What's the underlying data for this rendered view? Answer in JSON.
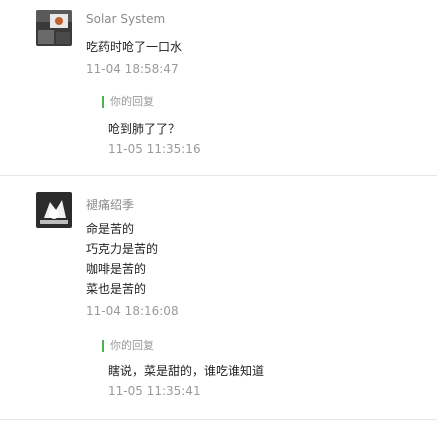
{
  "comments": [
    {
      "username": "Solar System",
      "lines": [
        "吃药时呛了一口水"
      ],
      "time": "11-04 18:58:47",
      "reply": {
        "label": "你的回复",
        "text": "呛到肺了了？",
        "time": "11-05 11:35:16"
      }
    },
    {
      "username": "褪痛绍季",
      "lines": [
        "命是苦的",
        "巧克力是苦的",
        "咖啡是苦的",
        "菜也是苦的"
      ],
      "time": "11-04 18:16:08",
      "reply": {
        "label": "你的回复",
        "text": "瞎说，菜是甜的，谁吃谁知道",
        "time": "11-05 11:35:41"
      }
    }
  ]
}
